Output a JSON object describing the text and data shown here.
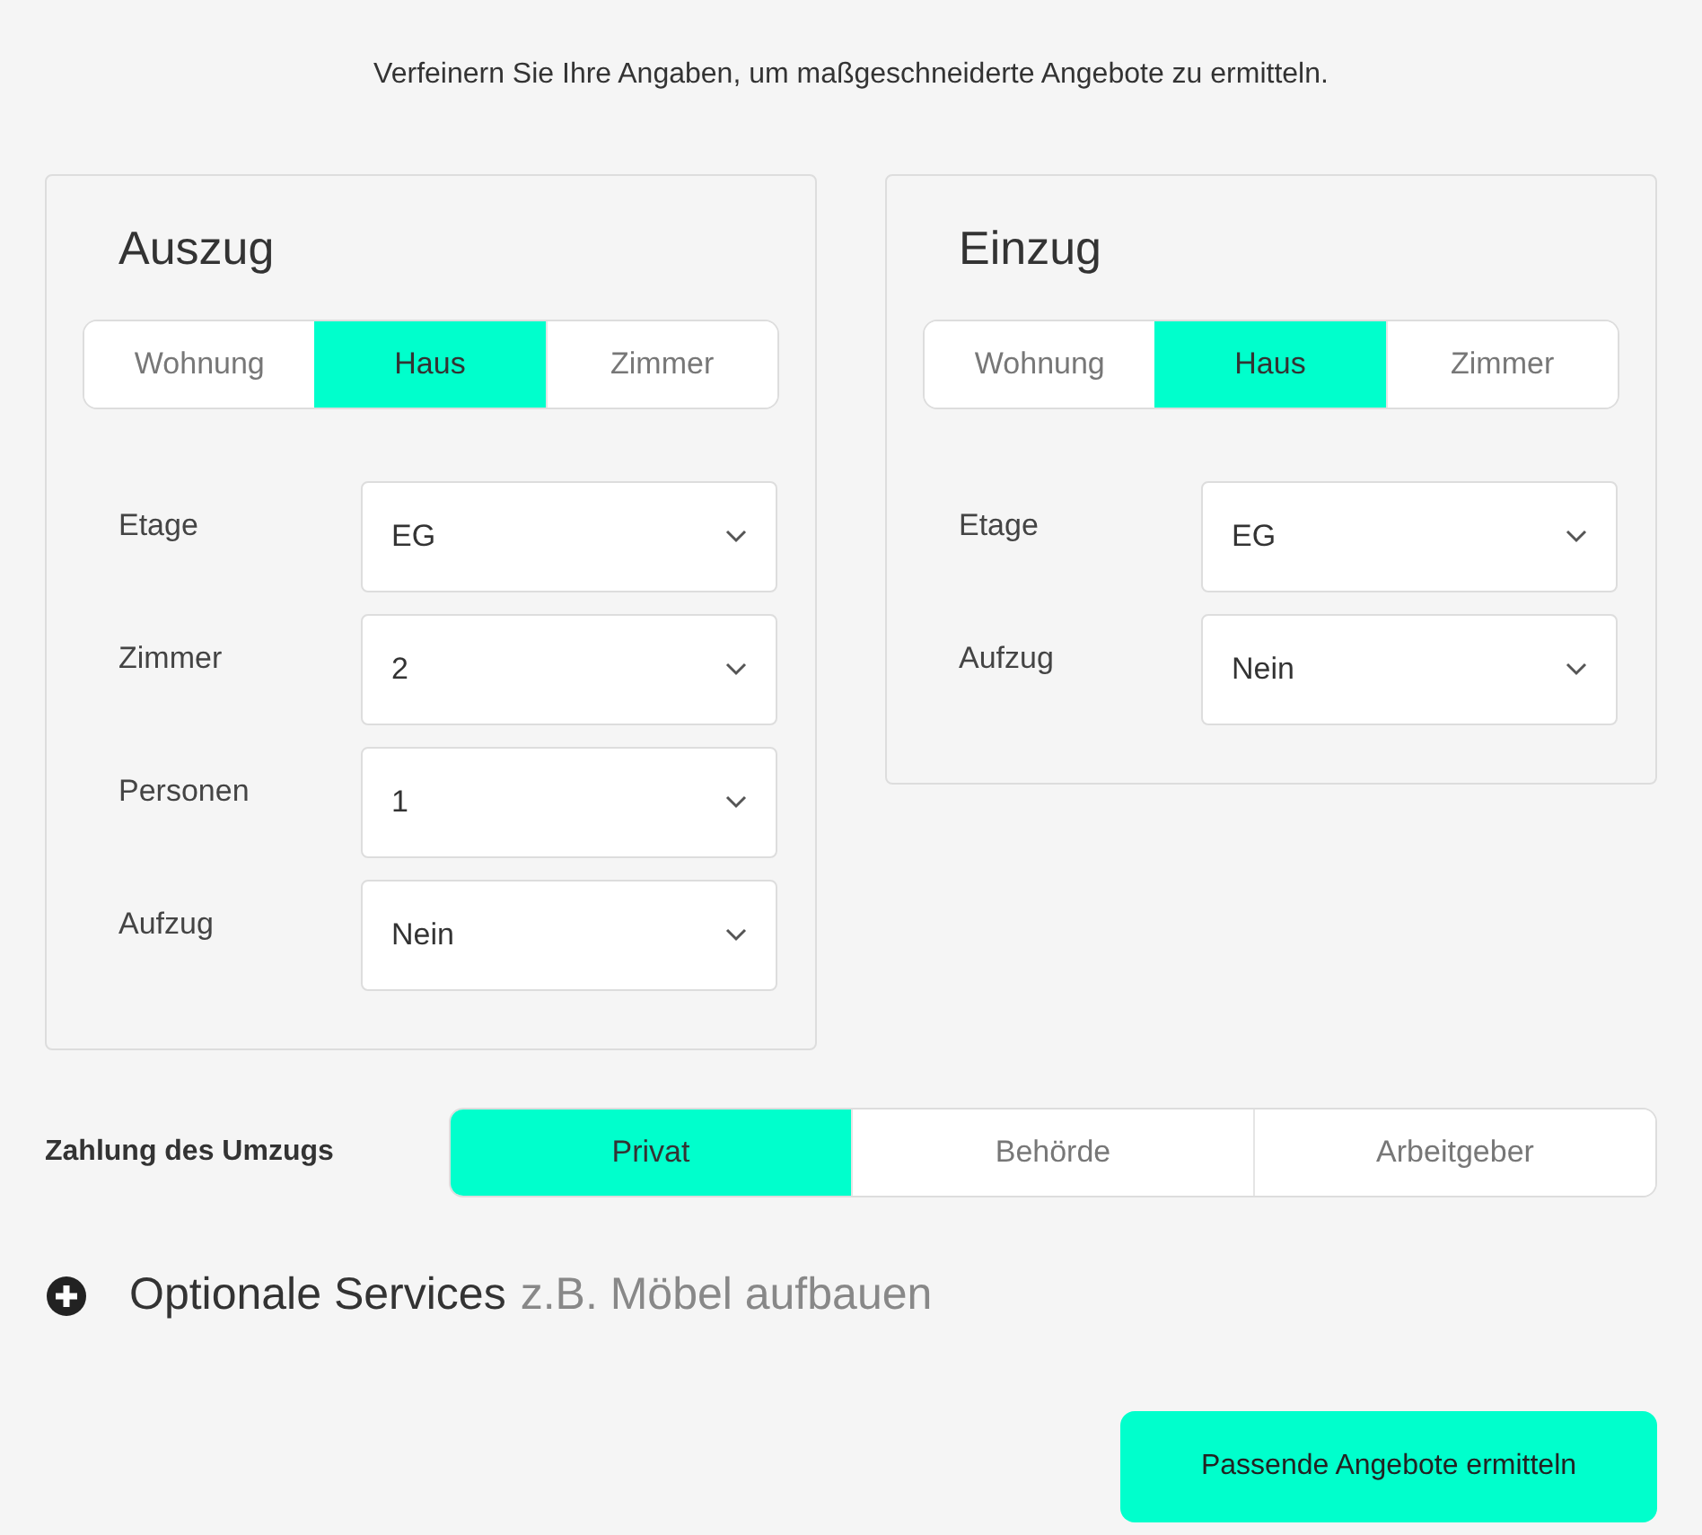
{
  "intro": "Verfeinern Sie Ihre Angaben, um maßgeschneiderte Angebote zu ermitteln.",
  "panels": [
    {
      "title": "Auszug",
      "types": [
        {
          "label": "Wohnung",
          "selected": false
        },
        {
          "label": "Haus",
          "selected": true
        },
        {
          "label": "Zimmer",
          "selected": false
        }
      ],
      "fields": [
        {
          "label": "Etage",
          "value": "EG"
        },
        {
          "label": "Zimmer",
          "value": "2"
        },
        {
          "label": "Personen",
          "value": "1"
        },
        {
          "label": "Aufzug",
          "value": "Nein"
        }
      ]
    },
    {
      "title": "Einzug",
      "types": [
        {
          "label": "Wohnung",
          "selected": false
        },
        {
          "label": "Haus",
          "selected": true
        },
        {
          "label": "Zimmer",
          "selected": false
        }
      ],
      "fields": [
        {
          "label": "Etage",
          "value": "EG"
        },
        {
          "label": "Aufzug",
          "value": "Nein"
        }
      ]
    }
  ],
  "payment": {
    "label": "Zahlung des Umzugs",
    "options": [
      {
        "label": "Privat",
        "selected": true
      },
      {
        "label": "Behörde",
        "selected": false
      },
      {
        "label": "Arbeitgeber",
        "selected": false
      }
    ]
  },
  "optional_services": {
    "title": "Optionale Services",
    "hint": "z.B. Möbel aufbauen",
    "expanded": false
  },
  "submit": "Passende Angebote ermitteln"
}
